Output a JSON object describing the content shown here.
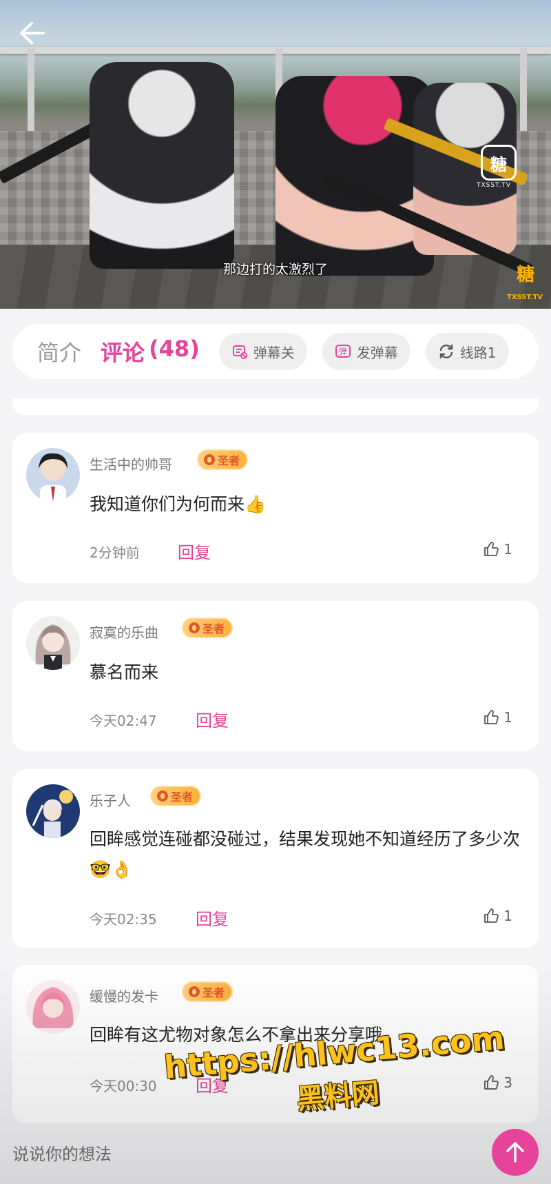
{
  "video": {
    "subtitle": "那边打的太激烈了",
    "watermark_badge": "糖",
    "watermark_sub": "TXSST.TV",
    "corner_logo": "糖",
    "corner_sub": "TXSST.TV"
  },
  "tabs": {
    "intro_label": "简介",
    "comments_label": "评论",
    "comments_count": "(48)",
    "danmaku_toggle_label": "弹幕关",
    "send_danmaku_label": "发弹幕",
    "route_label": "线路1"
  },
  "comments": [
    {
      "username": "生活中的帅哥",
      "badge": "圣者",
      "content": "我知道你们为何而来👍",
      "time": "2分钟前",
      "reply_label": "回复",
      "likes": "1"
    },
    {
      "username": "寂寞的乐曲",
      "badge": "圣者",
      "content": "慕名而来",
      "time": "今天02:47",
      "reply_label": "回复",
      "likes": "1"
    },
    {
      "username": "乐子人",
      "badge": "圣者",
      "content": "回眸感觉连碰都没碰过，结果发现她不知道经历了多少次🤓👌",
      "time": "今天02:35",
      "reply_label": "回复",
      "likes": "1"
    },
    {
      "username": "缓慢的发卡",
      "badge": "圣者",
      "content": "回眸有这尤物对象怎么不拿出来分享哦",
      "time": "今天00:30",
      "reply_label": "回复",
      "likes": "3"
    }
  ],
  "input": {
    "placeholder": "说说你的想法"
  },
  "overlay_watermark": {
    "line1": "https://hlwc13.com",
    "line2": "黑料网"
  },
  "colors": {
    "accent": "#e6439a",
    "badge_gold": "#ffb13b"
  }
}
